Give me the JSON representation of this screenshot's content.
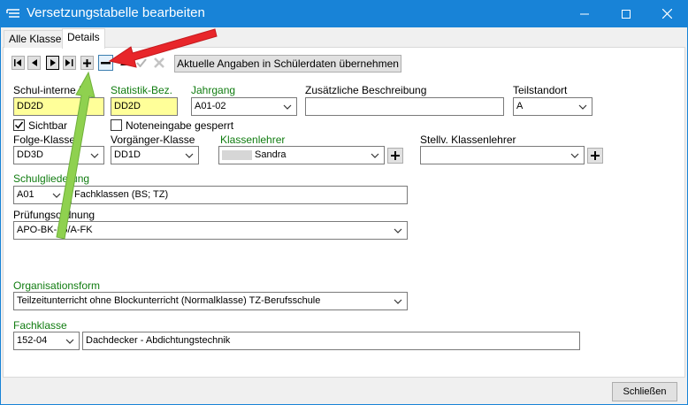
{
  "window": {
    "title": "Versetzungstabelle bearbeiten"
  },
  "tabs": [
    {
      "label": "Alle Klassen"
    },
    {
      "label": "Details"
    }
  ],
  "toolbar": {
    "apply_label": "Aktuelle Angaben in Schülerdaten übernehmen"
  },
  "form": {
    "schul_interne_bez": {
      "label": "Schul-interne Be",
      "value": "DD2D"
    },
    "statistik_bez": {
      "label": "Statistik-Bez.",
      "value": "DD2D"
    },
    "jahrgang": {
      "label": "Jahrgang",
      "value": "A01-02"
    },
    "zusaetzliche_beschreibung": {
      "label": "Zusätzliche Beschreibung",
      "value": ""
    },
    "teilstandort": {
      "label": "Teilstandort",
      "value": "A"
    },
    "sichtbar": {
      "label": "Sichtbar",
      "checked": true
    },
    "noteneingabe_gesperrt": {
      "label": "Noteneingabe gesperrt",
      "checked": false
    },
    "folge_klasse": {
      "label": "Folge-Klasse",
      "value": "DD3D"
    },
    "vorgaenger_klasse": {
      "label": "Vorgänger-Klasse",
      "value": "DD1D"
    },
    "klassenlehrer": {
      "label": "Klassenlehrer",
      "value": "Sandra"
    },
    "stellv_klassenlehrer": {
      "label": "Stellv. Klassenlehrer",
      "value": ""
    },
    "schulgliederung": {
      "label": "Schulgliederung",
      "code": "A01",
      "text": "Fachklassen (BS; TZ)"
    },
    "pruefungsordnung": {
      "label": "Prüfungsordnung",
      "value": "APO-BK-15/A-FK"
    },
    "organisationsform": {
      "label": "Organisationsform",
      "value": "Teilzeitunterricht ohne Blockunterricht (Normalklasse) TZ-Berufsschule"
    },
    "fachklasse": {
      "label": "Fachklasse",
      "code": "152-04",
      "text": "Dachdecker - Abdichtungstechnik"
    }
  },
  "buttons": {
    "close_label": "Schließen"
  },
  "colors": {
    "titlebar": "#1883d7",
    "required_label": "#107c10",
    "highlight_field": "#ffff99",
    "arrow_red": "#e8262a",
    "arrow_green": "#8fd14f"
  }
}
